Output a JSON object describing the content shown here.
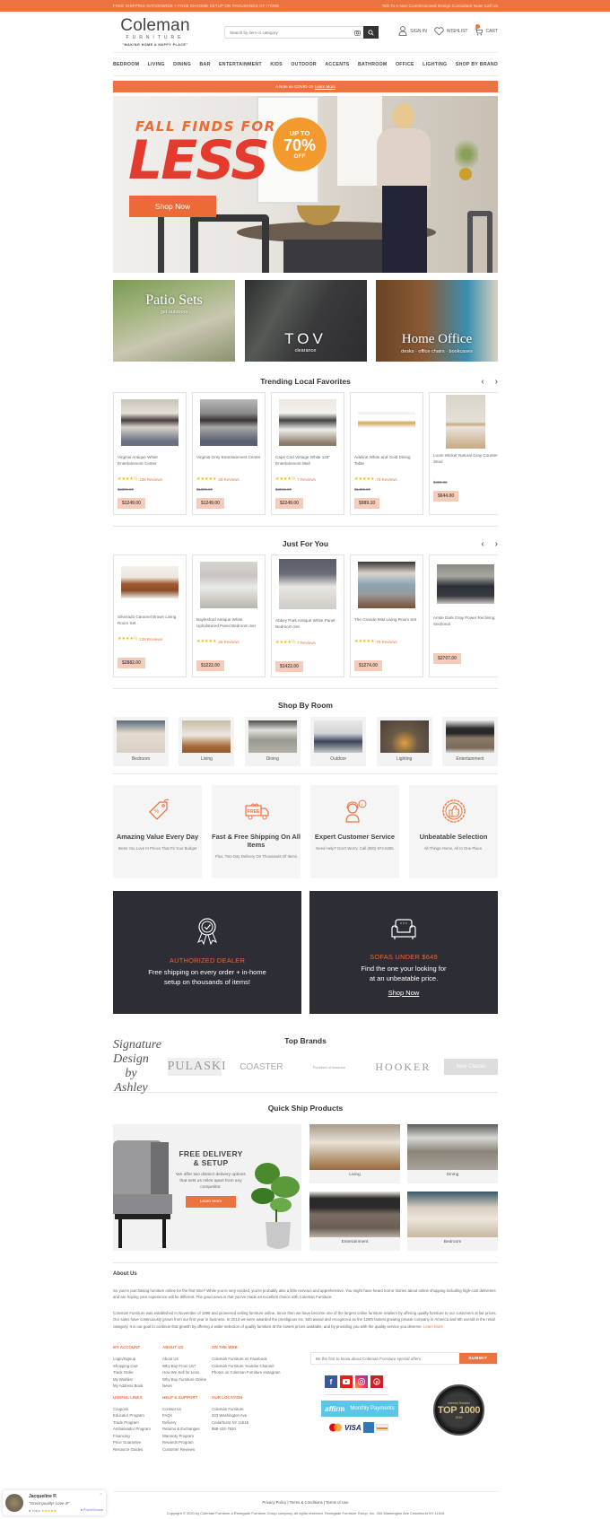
{
  "topbar": {
    "left": "FREE SHIPPING NATIONWIDE + FREE IN-HOME SETUP ON THOUSANDS OF ITEMS",
    "right": "Talk To A Non-Commissioned Design Consultant Now! Call Us"
  },
  "header": {
    "logo_name": "Coleman",
    "logo_sub": "FURNITURE",
    "logo_tagline": "\"MAKING HOME A HAPPY PLACE\"",
    "search_placeholder": "Search by item or category",
    "sign_in": "SIGN IN",
    "wishlist": "WISHLIST",
    "cart": "CART",
    "cart_count": "0"
  },
  "nav": [
    "BEDROOM",
    "LIVING",
    "DINING",
    "BAR",
    "ENTERTAINMENT",
    "KIDS",
    "OUTDOOR",
    "ACCENTS",
    "BATHROOM",
    "OFFICE",
    "LIGHTING",
    "SHOP BY BRAND"
  ],
  "covid": {
    "text": "A Note on COVID-19",
    "link": "Learn More"
  },
  "hero": {
    "line1": "FALL FINDS FOR",
    "line2": "LESS",
    "badge_top": "UP TO",
    "badge_mid": "70%",
    "badge_bottom": "OFF",
    "cta": "Shop Now"
  },
  "promos": [
    {
      "title": "Patio Sets",
      "subtitle": "get outdoors"
    },
    {
      "title": "TOV",
      "subtitle": "clearance"
    },
    {
      "title": "Home Office",
      "subtitle": "desks · office chairs · bookcases"
    }
  ],
  "trending": {
    "title": "Trending Local Favorites",
    "items": [
      {
        "name": "Virginia Antique White Entertainment Center",
        "stars": "★★★★½",
        "reviews": "138 Reviews",
        "old_price": "$2399.00",
        "price": "$1249.00"
      },
      {
        "name": "Virginia Grey Entertainment Center",
        "stars": "★★★★★",
        "reviews": "29 Reviews",
        "old_price": "$1899.00",
        "price": "$1249.00"
      },
      {
        "name": "Cape Cod Vintage White 126\" Entertainment Wall",
        "stars": "★★★★½",
        "reviews": "7 Reviews",
        "old_price": "$3019.00",
        "price": "$2249.00"
      },
      {
        "name": "Adeline White and Gold Dining Table",
        "stars": "★★★★★",
        "reviews": "79 Reviews",
        "old_price": "$1400.00",
        "price": "$989.10"
      },
      {
        "name": "Loom Wicker Natural Gray Counter Stool",
        "stars": "",
        "reviews": "",
        "old_price": "$850.00",
        "price": "$644.00"
      }
    ]
  },
  "just_for_you": {
    "title": "Just For You",
    "items": [
      {
        "name": "Silverado Caramel Brown Living Room Set",
        "stars": "★★★★½",
        "reviews": "138 Reviews",
        "price": "$2882.00"
      },
      {
        "name": "Baylesford Antique White Upholstered Panel Bedroom Set",
        "stars": "★★★★★",
        "reviews": "29 Reviews",
        "price": "$1222.00"
      },
      {
        "name": "Abbey Park Antique White Panel Bedroom Set",
        "stars": "★★★★½",
        "reviews": "7 Reviews",
        "price": "$1422.00"
      },
      {
        "name": "The Grande Mist Living Room Set",
        "stars": "★★★★★",
        "reviews": "79 Reviews",
        "price": "$1274.00"
      },
      {
        "name": "Amite Dark Gray Power Reclining Sectional",
        "stars": "",
        "reviews": "",
        "price": "$2707.00"
      }
    ]
  },
  "shop_by_room": {
    "title": "Shop By Room",
    "rooms": [
      "Bedroom",
      "Living",
      "Dining",
      "Outdoor",
      "Lighting",
      "Entertainment"
    ]
  },
  "features": [
    {
      "title": "Amazing Value Every Day",
      "text": "Items You Love In Prices That Fit Your Budget"
    },
    {
      "title": "Fast & Free Shipping On All Items",
      "text": "Plus, Two-Day Delivery On Thousands Of Items"
    },
    {
      "title": "Expert Customer Service",
      "text": "Need Help? Don't Worry. Call (800) 974-5255"
    },
    {
      "title": "Unbeatable Selection",
      "text": "All Things Home, All In One Place."
    }
  ],
  "dark_boxes": [
    {
      "title": "AUTHORIZED DEALER",
      "text1": "Free shipping on every order + in-home",
      "text2": "setup on thousands of items!"
    },
    {
      "title": "SOFAS UNDER $649",
      "text1": "Find the one your looking for",
      "text2": "at an unbeatable price.",
      "link": "Shop Now"
    }
  ],
  "top_brands": {
    "title": "Top Brands",
    "brands": [
      "Signature Design by Ashley",
      "PULASKI",
      "COASTER",
      "Furniture of America",
      "HOOKER",
      "New Classic"
    ]
  },
  "quick_ship": {
    "title": "Quick Ship Products",
    "promo_title1": "FREE DELIVERY",
    "promo_title2": "& SETUP",
    "promo_text": "We offer two distinct delivery options that sets us miles apart from any competitor.",
    "promo_cta": "Learn More",
    "items": [
      "Living",
      "Dining",
      "Entertainment",
      "Bedroom"
    ]
  },
  "about": {
    "title": "About Us",
    "p1": "So you're purchasing furniture online for the first time? While you're very excited, you're probably also a little nervous and apprehensive. You might have heard horror stories about online shopping including high-cost deliveries and are hoping your experience will be different. The good news is that you've made an excellent choice with Coleman Furniture.",
    "p2": "Coleman Furniture was established in November of 1999 and pioneered selling furniture online. Since then we have become one of the largest online furniture retailers by offering quality furniture to our customers at fair prices. Our sales have continuously grown from our first year in business. In 2013 we were awarded the prestigious Inc. 500 award and recognized as the 126th fastest growing private company in America and 6th overall in the retail category. It is our goal to continue that growth by offering a wider selection of quality furniture at the lowest prices available, and by providing you with the quality service you deserve.",
    "learn_more": "Learn More"
  },
  "footer": {
    "my_account": {
      "title": "MY ACCOUNT",
      "links": [
        "Login/Signup",
        "Shopping Cart",
        "Track Order",
        "My Wishlist",
        "My Address Book"
      ]
    },
    "about_us": {
      "title": "ABOUT US",
      "links": [
        "About Us",
        "Why Buy From Us?",
        "How We Sell for Less",
        "Why Buy Furniture Online",
        "News"
      ]
    },
    "on_the_web": {
      "title": "ON THE WEB",
      "links": [
        "Coleman Furniture on Facebook",
        "Coleman Furniture Youtube Channel",
        "Photos on Coleman Furniture Instagram"
      ]
    },
    "useful_links": {
      "title": "USEFUL LINKS",
      "links": [
        "Coupons",
        "Educator Program",
        "Trade Program",
        "Ambassador Program",
        "Financing",
        "Price Guarantee",
        "Resource Guides"
      ]
    },
    "help_support": {
      "title": "HELP & SUPPORT",
      "links": [
        "Contact Us",
        "FAQs",
        "Delivery",
        "Returns & Exchanges",
        "Warranty Program",
        "Rewards Program",
        "Customer Reviews"
      ]
    },
    "our_location": {
      "title": "OUR LOCATION",
      "lines": [
        "Coleman Furniture",
        "333 Washington Ave",
        "Cedarhurst NY 11516",
        "888-434-7620"
      ]
    },
    "newsletter_placeholder": "Be the first to know about Coleman Furniture special offers",
    "submit": "SUBMIT",
    "affirm_logo": "affirm",
    "affirm_text": "Monthly Payments",
    "top1000_small": "Internet Retailer",
    "top1000": "TOP 1000",
    "top1000_year": "2019",
    "legal_links": "Privacy Policy  |  Terms & Conditions  |  Terms of Use",
    "copyright": "Copyright © 2020 by Coleman Furniture a Renegade Furniture Group company. All rights reserved. Renegade Furniture Group, Inc. 333 Washington Ave Cedarhurst NY 11516"
  },
  "proof_popup": {
    "name": "Jacqueline P.",
    "quote": "\"Great quality! Love it!\"",
    "source": "Yotpo",
    "stars": "★★★★★",
    "brand": "ProveSource"
  },
  "colors": {
    "accent": "#ec7340",
    "dark": "#2c2d35",
    "price_bg": "#f8cbb9",
    "star": "#f5b800"
  }
}
